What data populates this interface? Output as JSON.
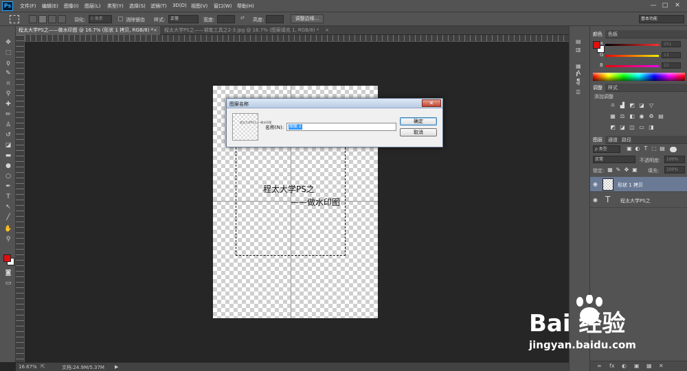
{
  "app": {
    "logo": "Ps"
  },
  "menu": [
    "文件(F)",
    "编辑(E)",
    "图像(I)",
    "图层(L)",
    "类型(Y)",
    "选择(S)",
    "滤镜(T)",
    "3D(D)",
    "视图(V)",
    "窗口(W)",
    "帮助(H)"
  ],
  "window_controls": [
    "—",
    "□",
    "✕"
  ],
  "options": {
    "feather_label": "羽化:",
    "feather_value": "0 像素",
    "antialias_label": "消除锯齿",
    "style_label": "样式:",
    "style_value": "正常",
    "width_label": "宽度:",
    "height_label": "高度:",
    "refine_button": "调整边缘...",
    "workspace": "基本功能"
  },
  "tabs": [
    {
      "label": "程太大学PS之——做水印图 @ 16.7% (形状 1 拷贝, RGB/8) *",
      "close": "×"
    },
    {
      "label": "程太大学PS之——钢笔工具之2-3.jpg @ 16.7% (图案填充 1, RGB/8) *",
      "close": "×"
    }
  ],
  "canvas": {
    "watermark_line1": "程太大学PS之",
    "watermark_line2": "——做水印图"
  },
  "status": {
    "zoom": "16.67%",
    "doc": "文档:24.9M/5.37M"
  },
  "color_panel": {
    "tabs": [
      "颜色",
      "色板"
    ],
    "foreground": "#e01010",
    "background": "#ffffff",
    "channels": [
      {
        "label": "R",
        "value": "251",
        "track": "#ff3030"
      },
      {
        "label": "G",
        "value": "13",
        "track": "#30d030"
      },
      {
        "label": "B",
        "value": "15",
        "track": "#d030ff"
      }
    ]
  },
  "adjust_panel": {
    "tabs": [
      "调整",
      "样式"
    ],
    "title": "添加调整"
  },
  "layers_panel": {
    "tabs": [
      "图层",
      "通道",
      "路径"
    ],
    "filter_label": "ρ 类型",
    "blend_mode": "正常",
    "opacity_label": "不透明度:",
    "opacity_value": "100%",
    "lock_label": "锁定:",
    "fill_label": "填充:",
    "fill_value": "100%",
    "layers": [
      {
        "name": "形状 1 拷贝",
        "selected": true
      },
      {
        "name": "程太大学PS之",
        "selected": false
      }
    ],
    "footer_icons": [
      "∞",
      "fx",
      "◐",
      "▣",
      "▦",
      "✕"
    ]
  },
  "dialog": {
    "title": "图案名称",
    "close": "✕",
    "thumb_text": "程太大学PS之 —做水印图",
    "name_label": "名称(N):",
    "name_value": "图案 2",
    "ok": "确定",
    "cancel": "取消"
  },
  "watermark": {
    "brand": "Bai 经验",
    "url": "jingyan.baidu.com"
  }
}
